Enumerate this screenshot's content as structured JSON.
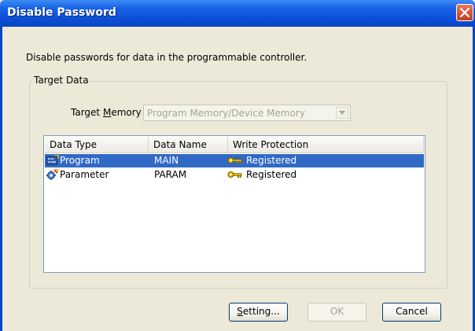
{
  "window": {
    "title": "Disable Password"
  },
  "description": "Disable passwords for data in the programmable controller.",
  "target_data": {
    "legend": "Target Data",
    "memory_label_prefix": "Target ",
    "memory_label_access": "M",
    "memory_label_suffix": "emory",
    "memory_value": "Program Memory/Device Memory"
  },
  "table": {
    "columns": [
      "Data Type",
      "Data Name",
      "Write Protection"
    ],
    "rows": [
      {
        "type": "Program",
        "name": "MAIN",
        "protection": "Registered",
        "selected": true,
        "icon": "program-icon"
      },
      {
        "type": "Parameter",
        "name": "PARAM",
        "protection": "Registered",
        "selected": false,
        "icon": "parameter-icon"
      }
    ]
  },
  "buttons": {
    "setting_access": "S",
    "setting_rest": "etting...",
    "ok": "OK",
    "cancel": "Cancel"
  },
  "colors": {
    "titlebar": "#0a4fd6",
    "selection": "#316ac5",
    "key": "#e8c000"
  }
}
